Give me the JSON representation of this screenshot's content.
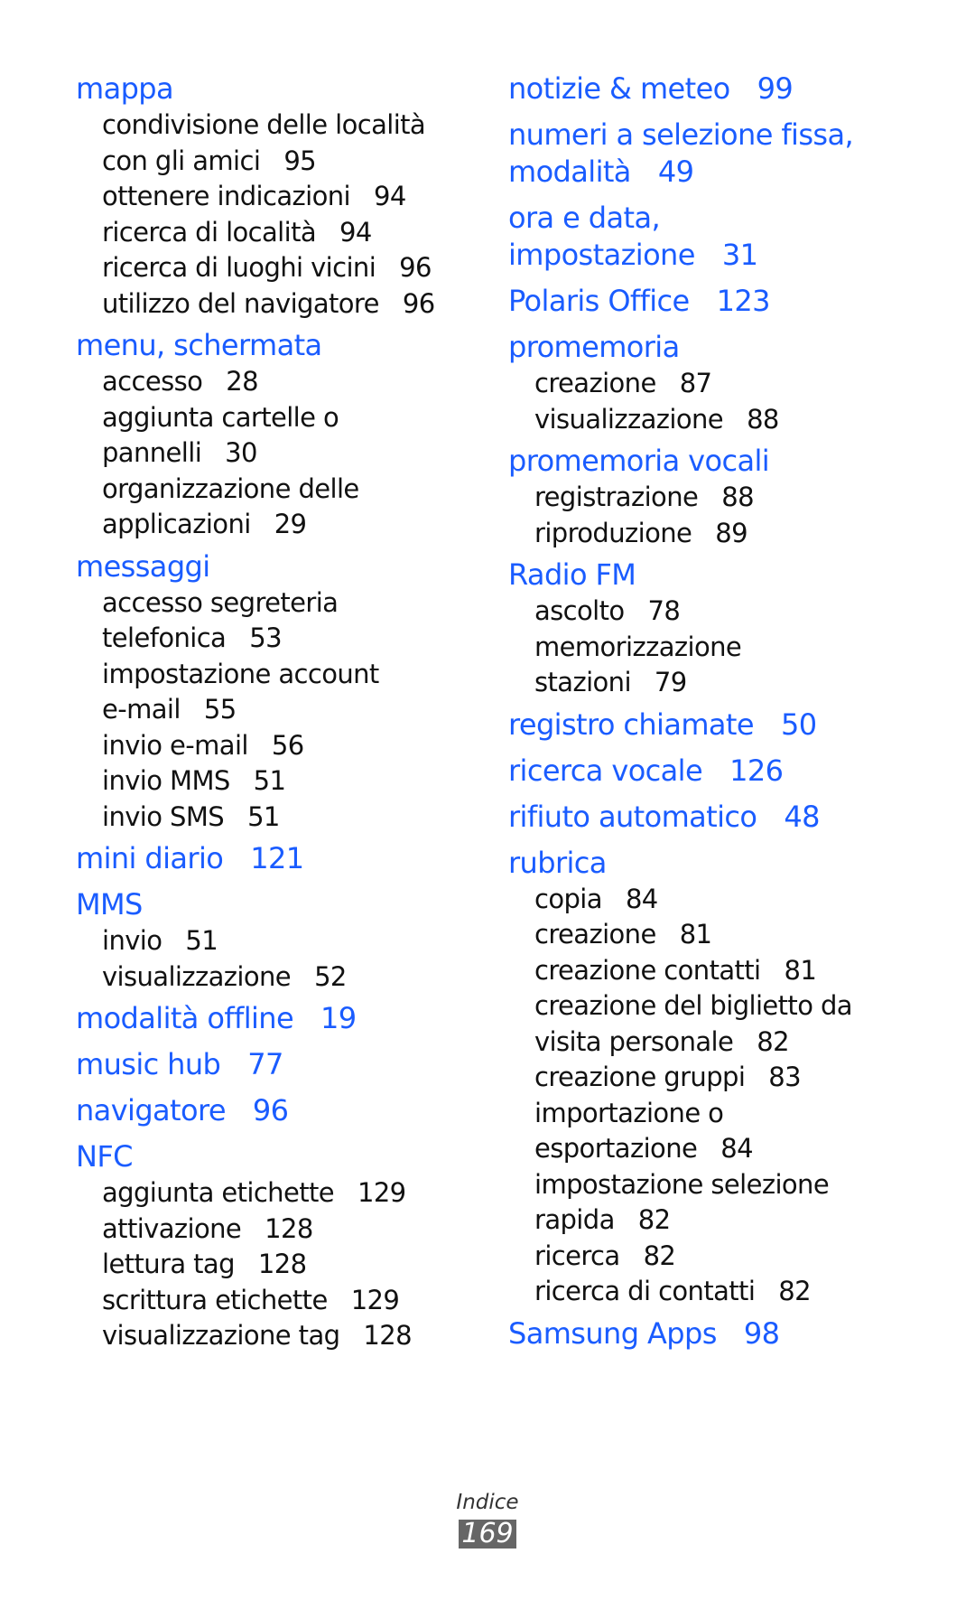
{
  "left_column": [
    {
      "head": "mappa",
      "page": "",
      "subs": [
        {
          "text": "condivisione delle località",
          "page": ""
        },
        {
          "text": "con gli amici",
          "page": "95"
        },
        {
          "text": "ottenere indicazioni",
          "page": "94"
        },
        {
          "text": "ricerca di località",
          "page": "94"
        },
        {
          "text": "ricerca di luoghi vicini",
          "page": "96"
        },
        {
          "text": "utilizzo del navigatore",
          "page": "96"
        }
      ]
    },
    {
      "head": "menu, schermata",
      "page": "",
      "subs": [
        {
          "text": "accesso",
          "page": "28"
        },
        {
          "text": "aggiunta cartelle o",
          "page": ""
        },
        {
          "text": "pannelli",
          "page": "30"
        },
        {
          "text": "organizzazione delle",
          "page": ""
        },
        {
          "text": "applicazioni",
          "page": "29"
        }
      ]
    },
    {
      "head": "messaggi",
      "page": "",
      "subs": [
        {
          "text": "accesso segreteria",
          "page": ""
        },
        {
          "text": "telefonica",
          "page": "53"
        },
        {
          "text": "impostazione account",
          "page": ""
        },
        {
          "text": "e-mail",
          "page": "55"
        },
        {
          "text": "invio e-mail",
          "page": "56"
        },
        {
          "text": "invio MMS",
          "page": "51"
        },
        {
          "text": "invio SMS",
          "page": "51"
        }
      ]
    },
    {
      "head": "mini diario",
      "page": "121",
      "subs": []
    },
    {
      "head": "MMS",
      "page": "",
      "subs": [
        {
          "text": "invio",
          "page": "51"
        },
        {
          "text": "visualizzazione",
          "page": "52"
        }
      ]
    },
    {
      "head": "modalità offline",
      "page": "19",
      "subs": []
    },
    {
      "head": "music hub",
      "page": "77",
      "subs": []
    },
    {
      "head": "navigatore",
      "page": "96",
      "subs": []
    },
    {
      "head": "NFC",
      "page": "",
      "subs": [
        {
          "text": "aggiunta etichette",
          "page": "129"
        },
        {
          "text": "attivazione",
          "page": "128"
        },
        {
          "text": "lettura tag",
          "page": "128"
        },
        {
          "text": "scrittura etichette",
          "page": "129"
        },
        {
          "text": "visualizzazione tag",
          "page": "128"
        }
      ]
    }
  ],
  "right_column": [
    {
      "head": "notizie & meteo",
      "page": "99",
      "subs": []
    },
    {
      "head_lines": [
        "numeri a selezione fissa,",
        "modalità"
      ],
      "page": "49",
      "subs": []
    },
    {
      "head_lines": [
        "ora e data,",
        "impostazione"
      ],
      "page": "31",
      "subs": []
    },
    {
      "head": "Polaris Office",
      "page": "123",
      "subs": []
    },
    {
      "head": "promemoria",
      "page": "",
      "subs": [
        {
          "text": "creazione",
          "page": "87"
        },
        {
          "text": "visualizzazione",
          "page": "88"
        }
      ]
    },
    {
      "head": "promemoria vocali",
      "page": "",
      "subs": [
        {
          "text": "registrazione",
          "page": "88"
        },
        {
          "text": "riproduzione",
          "page": "89"
        }
      ]
    },
    {
      "head": "Radio FM",
      "page": "",
      "subs": [
        {
          "text": "ascolto",
          "page": "78"
        },
        {
          "text": "memorizzazione",
          "page": ""
        },
        {
          "text": "stazioni",
          "page": "79"
        }
      ]
    },
    {
      "head": "registro chiamate",
      "page": "50",
      "subs": []
    },
    {
      "head": "ricerca vocale",
      "page": "126",
      "subs": []
    },
    {
      "head": "rifiuto automatico",
      "page": "48",
      "subs": []
    },
    {
      "head": "rubrica",
      "page": "",
      "subs": [
        {
          "text": "copia",
          "page": "84"
        },
        {
          "text": "creazione",
          "page": "81"
        },
        {
          "text": "creazione contatti",
          "page": "81"
        },
        {
          "text": "creazione del biglietto da",
          "page": ""
        },
        {
          "text": "visita personale",
          "page": "82"
        },
        {
          "text": "creazione gruppi",
          "page": "83"
        },
        {
          "text": "importazione o",
          "page": ""
        },
        {
          "text": "esportazione",
          "page": "84"
        },
        {
          "text": "impostazione selezione",
          "page": ""
        },
        {
          "text": "rapida",
          "page": "82"
        },
        {
          "text": "ricerca",
          "page": "82"
        },
        {
          "text": "ricerca di contatti",
          "page": "82"
        }
      ]
    },
    {
      "head": "Samsung Apps",
      "page": "98",
      "subs": []
    }
  ],
  "footer": {
    "section": "Indice",
    "page_number": "169"
  },
  "colors": {
    "heading": "#1a5cff",
    "text": "#111111",
    "page_badge": "#666666"
  }
}
